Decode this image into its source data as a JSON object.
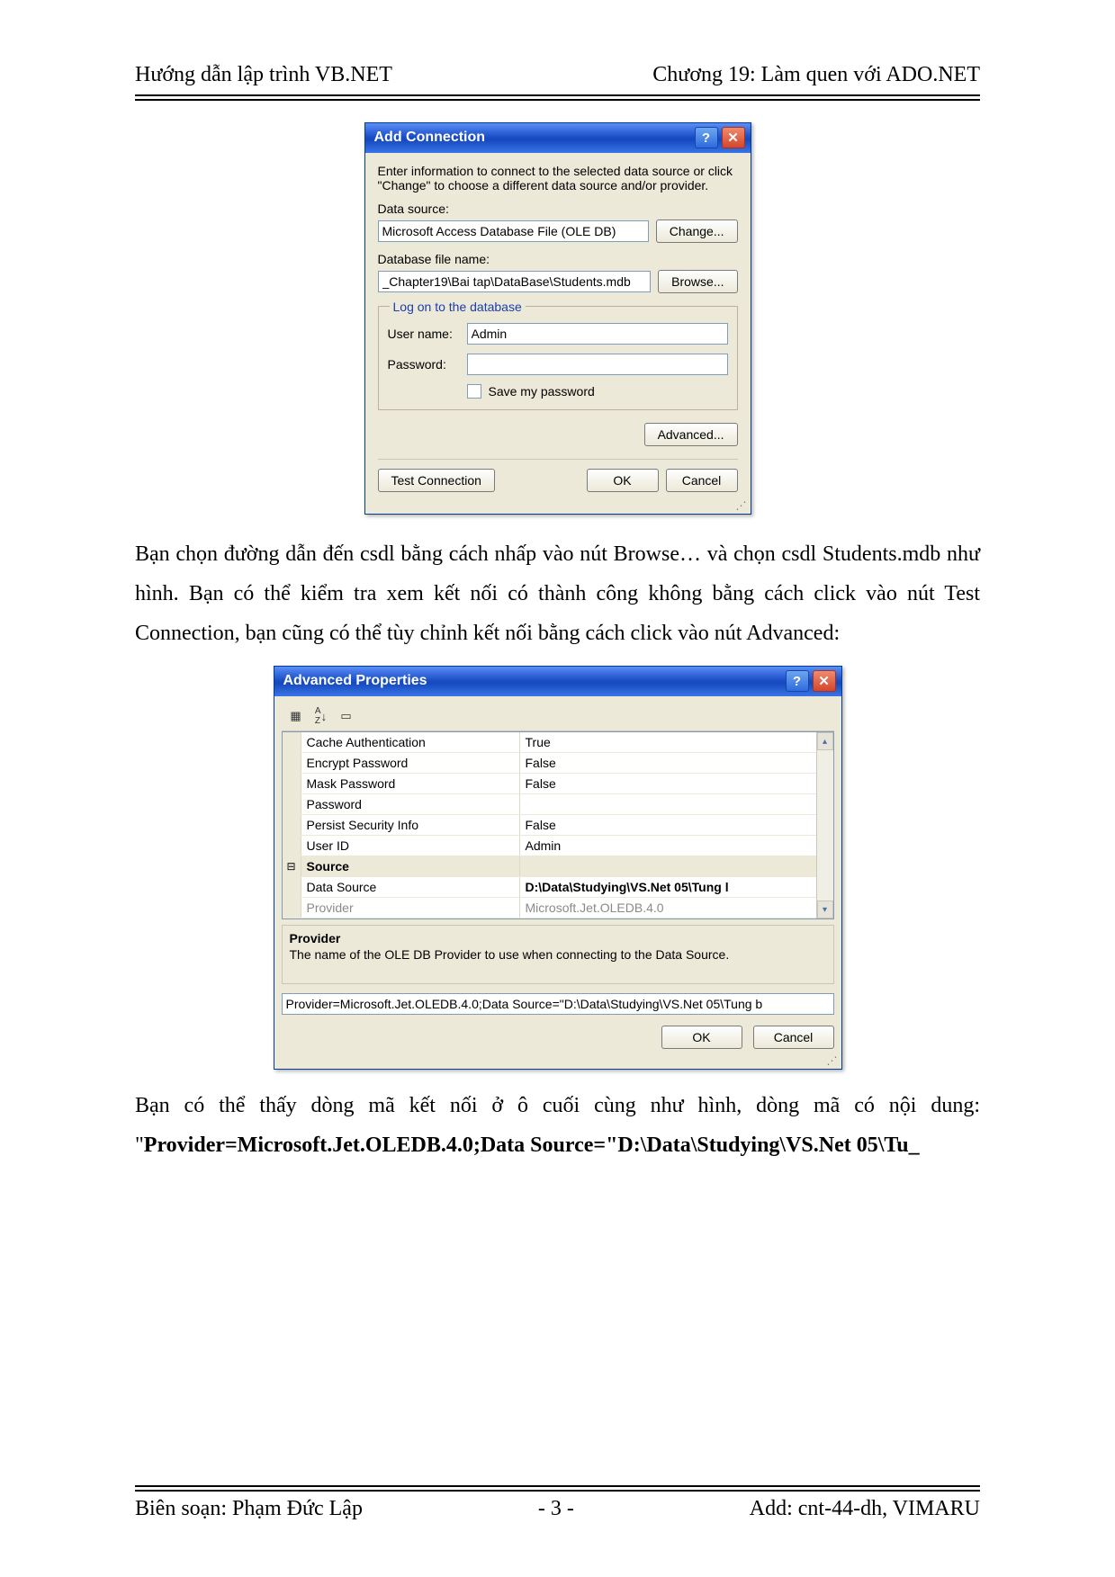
{
  "header": {
    "left": "Hướng dẫn lập trình VB.NET",
    "right": "Chương 19: Làm quen với ADO.NET"
  },
  "dialog_add_connection": {
    "title": "Add Connection",
    "intro": "Enter information to connect to the selected data source or click \"Change\" to choose a different data source and/or provider.",
    "data_source_label": "Data source:",
    "data_source_value": "Microsoft Access Database File (OLE DB)",
    "change_btn": "Change...",
    "db_file_label": "Database file name:",
    "db_file_value": "_Chapter19\\Bai tap\\DataBase\\Students.mdb",
    "browse_btn": "Browse...",
    "logon_group": "Log on to the database",
    "user_label": "User name:",
    "user_value": "Admin",
    "pass_label": "Password:",
    "pass_value": "",
    "save_pw_label": "Save my password",
    "advanced_btn": "Advanced...",
    "test_btn": "Test Connection",
    "ok_btn": "OK",
    "cancel_btn": "Cancel"
  },
  "para1": "Bạn chọn đường dẫn đến csdl bằng cách nhấp vào nút Browse… và chọn csdl Students.mdb như hình. Bạn có thể kiểm tra xem kết nối có thành công không bằng cách click vào nút Test Connection, bạn cũng có thể tùy chỉnh kết nối bằng cách click vào nút Advanced:",
  "dialog_advanced": {
    "title": "Advanced Properties",
    "rows": [
      {
        "gutter": "",
        "name": "Cache Authentication",
        "value": "True",
        "group": false
      },
      {
        "gutter": "",
        "name": "Encrypt Password",
        "value": "False",
        "group": false
      },
      {
        "gutter": "",
        "name": "Mask Password",
        "value": "False",
        "group": false
      },
      {
        "gutter": "",
        "name": "Password",
        "value": "",
        "group": false
      },
      {
        "gutter": "",
        "name": "Persist Security Info",
        "value": "False",
        "group": false
      },
      {
        "gutter": "",
        "name": "User ID",
        "value": "Admin",
        "group": false
      },
      {
        "gutter": "⊟",
        "name": "Source",
        "value": "",
        "group": true
      },
      {
        "gutter": "",
        "name": "Data Source",
        "value": "D:\\Data\\Studying\\VS.Net 05\\Tung l",
        "group": false,
        "bold": true
      },
      {
        "gutter": "",
        "name": "Provider",
        "value": "Microsoft.Jet.OLEDB.4.0",
        "group": false,
        "disabled": true
      }
    ],
    "help_title": "Provider",
    "help_text": "The name of the OLE DB Provider to use when connecting to the Data Source.",
    "conn_string": "Provider=Microsoft.Jet.OLEDB.4.0;Data Source=\"D:\\Data\\Studying\\VS.Net 05\\Tung b",
    "ok_btn": "OK",
    "cancel_btn": "Cancel"
  },
  "para2_a": "Bạn có thể thấy dòng mã kết nối ở ô cuối cùng như hình, dòng mã có nội dung: \"",
  "para2_b": "Provider=Microsoft.Jet.OLEDB.4.0;Data Source=\"D:\\Data\\Studying\\VS.Net 05\\Tu_",
  "footer": {
    "left": "Biên soạn: Phạm Đức Lập",
    "center": "- 3 -",
    "right": "Add: cnt-44-dh, VIMARU"
  }
}
